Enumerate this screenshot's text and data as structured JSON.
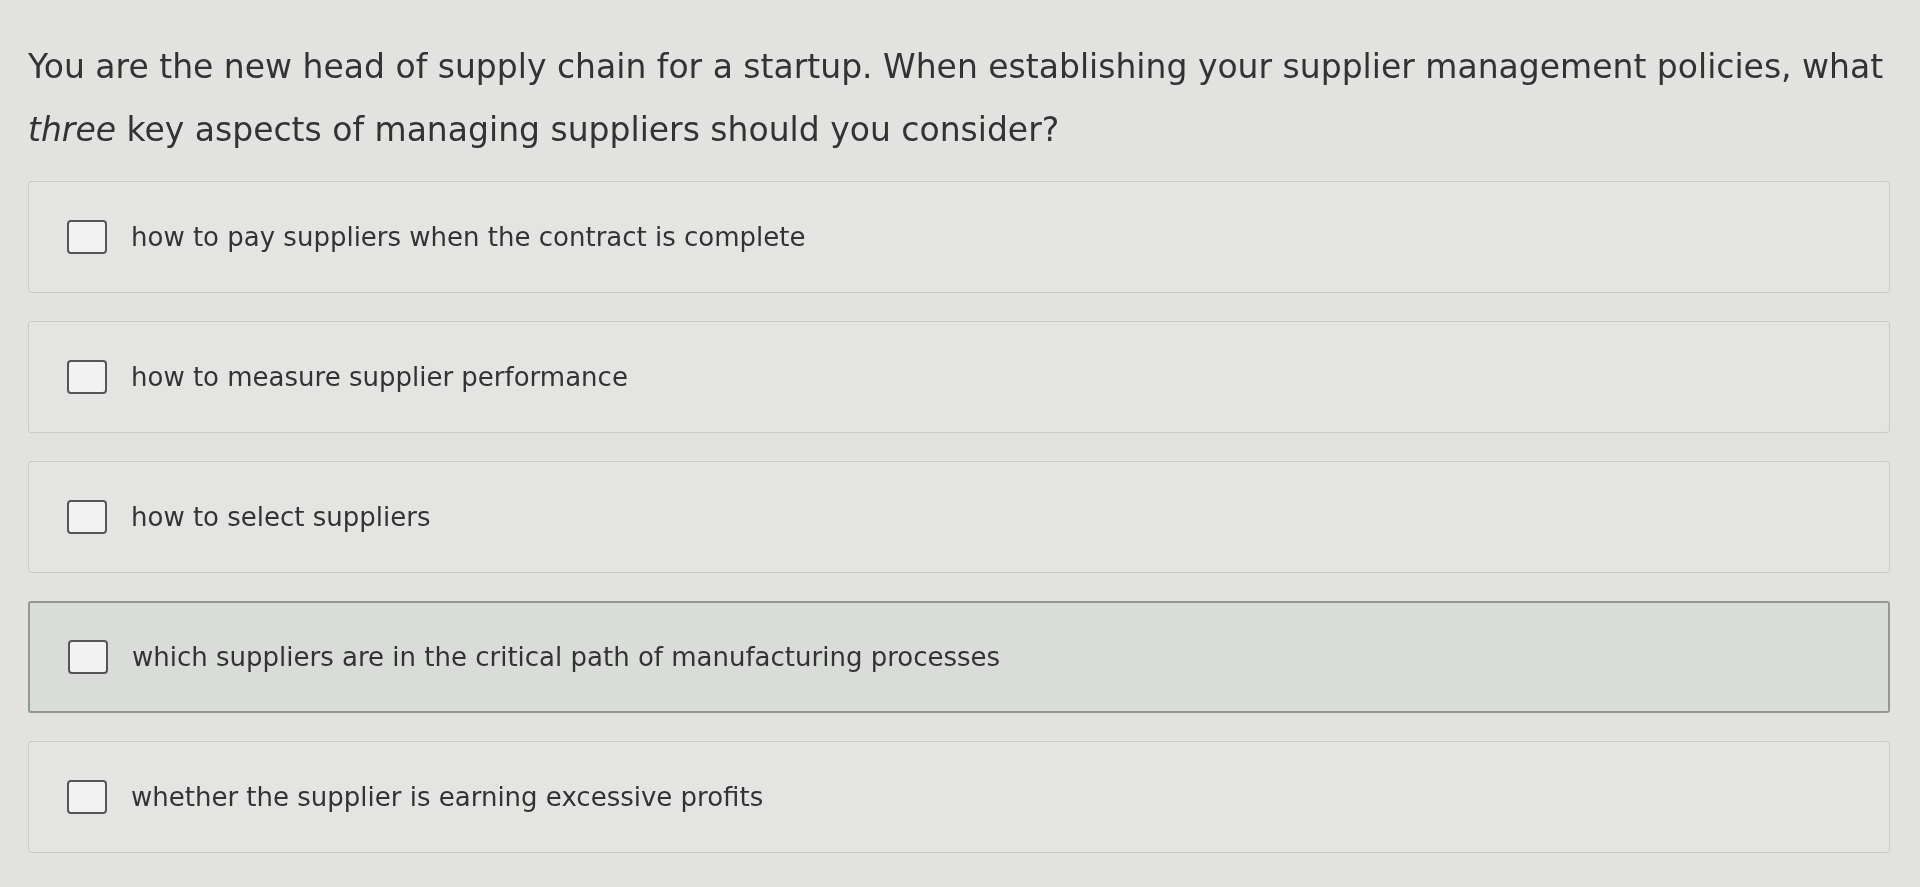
{
  "question": "You are the new head of supply chain for a startup. When establishing your supplier management policies, what *three* key aspects of managing suppliers should you consider?",
  "options": [
    {
      "label": "how to pay suppliers when the contract is complete",
      "checked": false,
      "highlighted": false
    },
    {
      "label": "how to measure supplier performance",
      "checked": false,
      "highlighted": false
    },
    {
      "label": "how to select suppliers",
      "checked": false,
      "highlighted": false
    },
    {
      "label": "which suppliers are in the critical path of manufacturing processes",
      "checked": false,
      "highlighted": true
    },
    {
      "label": "whether the supplier is earning excessive profits",
      "checked": false,
      "highlighted": false
    }
  ]
}
